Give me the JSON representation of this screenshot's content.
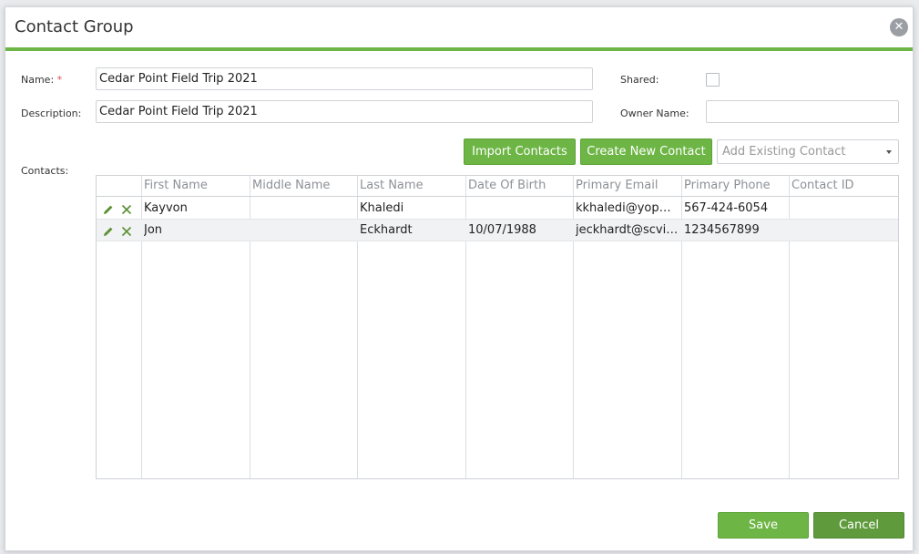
{
  "dialog": {
    "title": "Contact Group",
    "close_glyph": "✕"
  },
  "form": {
    "name_label": "Name:",
    "required_mark": "*",
    "name_value": "Cedar Point Field Trip 2021",
    "description_label": "Description:",
    "description_value": "Cedar Point Field Trip 2021",
    "shared_label": "Shared:",
    "shared_checked": false,
    "owner_label": "Owner Name:",
    "owner_value": "",
    "contacts_label": "Contacts:"
  },
  "toolbar": {
    "import_label": "Import Contacts",
    "create_label": "Create New Contact",
    "add_existing_placeholder": "Add Existing Contact"
  },
  "grid": {
    "columns": [
      "First Name",
      "Middle Name",
      "Last Name",
      "Date Of Birth",
      "Primary Email",
      "Primary Phone",
      "Contact ID"
    ],
    "rows": [
      {
        "first": "Kayvon",
        "middle": "",
        "last": "Khaledi",
        "dob": "",
        "email": "kkhaledi@yopm...",
        "phone": "567-424-6054",
        "id": ""
      },
      {
        "first": "Jon",
        "middle": "",
        "last": "Eckhardt",
        "dob": "10/07/1988",
        "email": "jeckhardt@scvie...",
        "phone": "1234567899",
        "id": ""
      }
    ]
  },
  "footer": {
    "save_label": "Save",
    "cancel_label": "Cancel"
  },
  "colors": {
    "accent": "#6db545",
    "accent_dark": "#5f9b3d",
    "edit_icon": "#5a8f32"
  },
  "icons": {
    "edit": "pencil-icon",
    "delete": "x-icon",
    "close": "close-icon"
  }
}
